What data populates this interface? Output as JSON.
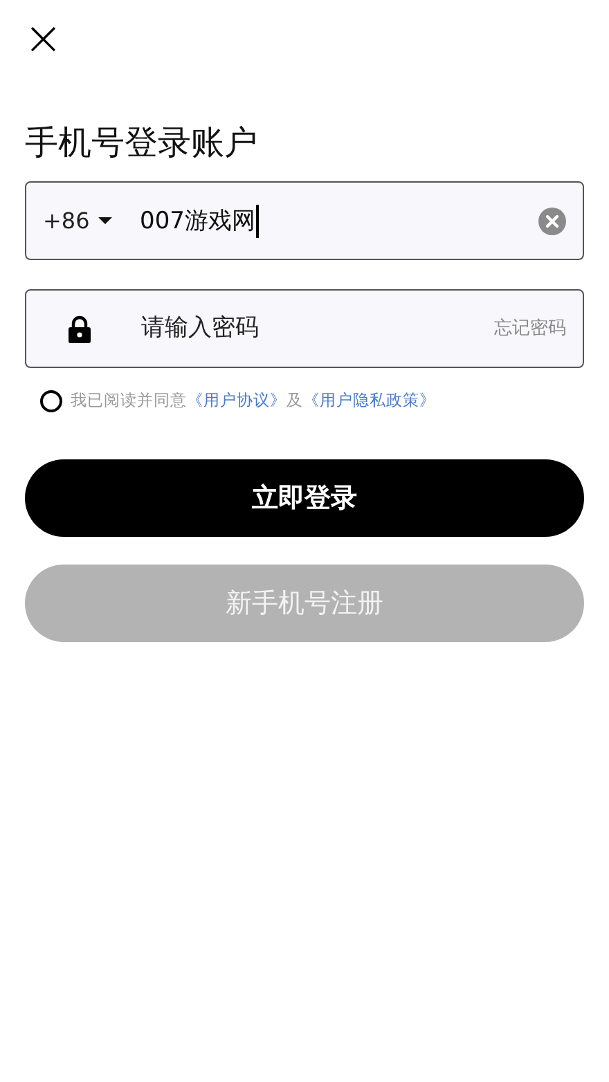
{
  "close": {
    "symbol": "×"
  },
  "title": "手机号登录账户",
  "phone": {
    "country_code": "+86",
    "value": "007游戏网",
    "focused": true
  },
  "password": {
    "placeholder": "请输入密码",
    "forgot": "忘记密码"
  },
  "agreement": {
    "checked": false,
    "text": "我已阅读并同意",
    "links": [
      "《用户协议》",
      "《用户隐私政策》"
    ],
    "joiner": "及"
  },
  "buttons": [
    {
      "label": "立即登录",
      "disabled": false
    },
    {
      "label": "新手机号注册",
      "disabled": true
    }
  ]
}
